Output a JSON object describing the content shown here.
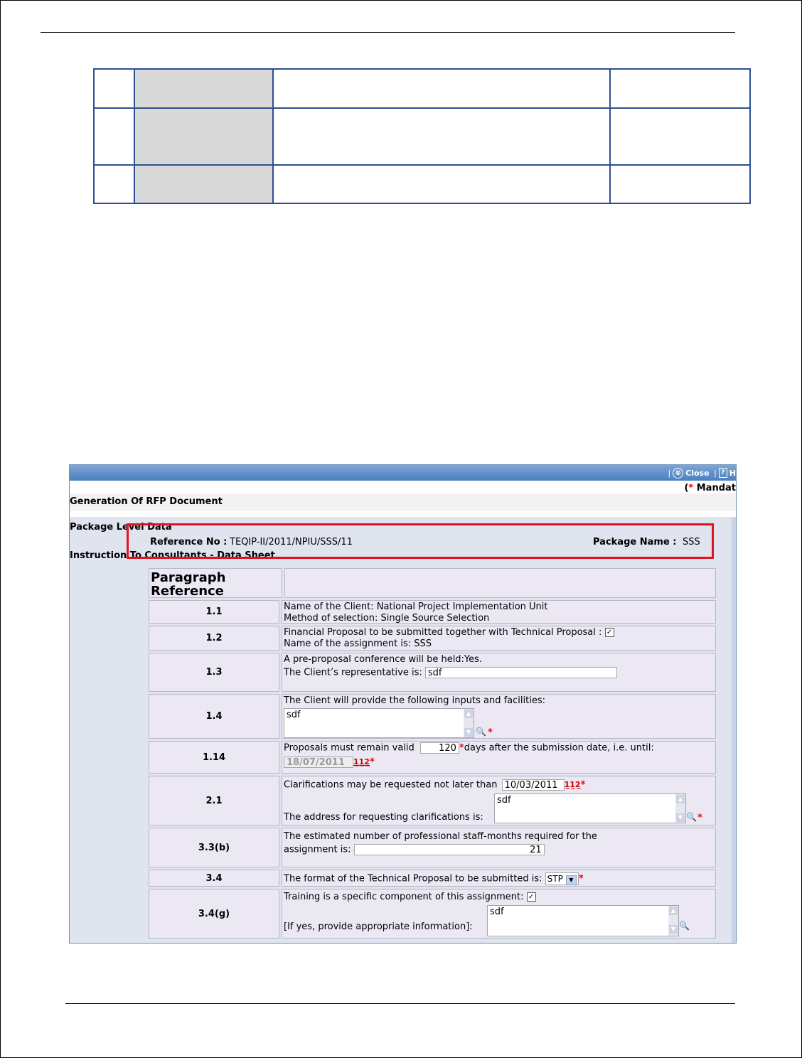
{
  "app": {
    "close_label": "Close",
    "help_label": "H",
    "mandatory_label": "Mandat",
    "page_title": "Generation Of RFP Document",
    "package_section_label": "Package Level Data",
    "reference_label": "Reference No :",
    "reference_value": "TEQIP-II/2011/NPIU/SSS/11",
    "package_name_label": "Package Name :",
    "package_name_value": "SSS",
    "itc_label": "Instruction To Consultants - Data Sheet",
    "star": "*"
  },
  "datasheet": {
    "header_ref": "Paragraph Reference",
    "rows": [
      {
        "ref": "1.1",
        "line1": "Name of the Client:  National Project Implementation Unit",
        "line2": "Method of selection: Single Source Selection"
      },
      {
        "ref": "1.2",
        "line1": "Financial Proposal to be submitted together with Technical Proposal :",
        "line2": "Name of the assignment is: SSS",
        "checked": "✓"
      },
      {
        "ref": "1.3",
        "line1": "A pre-proposal conference will be held:Yes.",
        "line2": "The Client’s representative is:",
        "value": "sdf"
      },
      {
        "ref": "1.4",
        "line1": "The Client will provide the following inputs and facilities:",
        "value": "sdf"
      },
      {
        "ref": "1.14",
        "line1": "Proposals must remain valid",
        "days": "120",
        "line2": "days after the submission date, i.e. until:",
        "date": "18/07/2011"
      },
      {
        "ref": "2.1",
        "line1": "Clarifications may be requested not later than",
        "date": "10/03/2011",
        "line2": "The address for requesting clarifications is:",
        "value": "sdf"
      },
      {
        "ref": "3.3(b)",
        "line1": "The estimated number of professional staff-months required for the",
        "line2": "assignment is:",
        "value": "21"
      },
      {
        "ref": "3.4",
        "line1": "The format of the Technical Proposal to be submitted is:",
        "select": "STP"
      },
      {
        "ref": "3.4(g)",
        "line1": "Training is a specific component of this assignment:",
        "line2": "[If yes, provide appropriate information]:",
        "value": "sdf",
        "checked": "✓"
      }
    ]
  },
  "icons": {
    "calendar": "1̲1̲2̲",
    "magnifier": "🔍",
    "close": "⊗",
    "help": "?"
  }
}
